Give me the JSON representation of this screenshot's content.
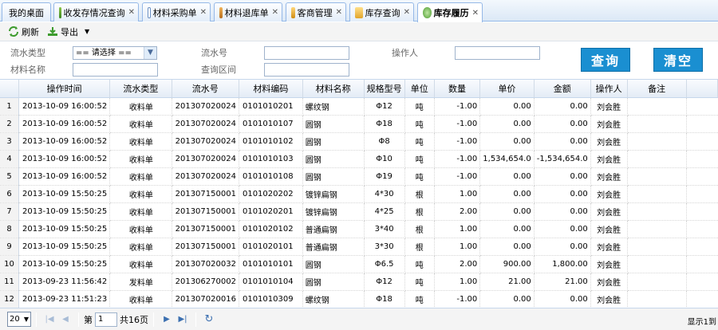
{
  "tabs": [
    {
      "label": "我的桌面",
      "closable": false
    },
    {
      "label": "收发存情况查询",
      "closable": true,
      "icon": "chart-icon"
    },
    {
      "label": "材料采购单",
      "closable": true,
      "icon": "document-icon"
    },
    {
      "label": "材料退库单",
      "closable": true,
      "icon": "truck-icon"
    },
    {
      "label": "客商管理",
      "closable": true,
      "icon": "merchant-icon"
    },
    {
      "label": "库存查询",
      "closable": true,
      "icon": "folder-icon"
    },
    {
      "label": "库存履历",
      "closable": true,
      "icon": "globe-icon",
      "active": true
    }
  ],
  "toolbar": {
    "refresh_label": "刷新",
    "export_label": "导出",
    "export_arrow": "▼"
  },
  "form": {
    "flow_type_label": "流水类型",
    "flow_type_value": "== 请选择 ==",
    "flow_no_label": "流水号",
    "operator_label": "操作人",
    "material_name_label": "材料名称",
    "query_range_label": "查询区间",
    "search_button": "查询",
    "clear_button": "清空"
  },
  "table": {
    "columns": [
      "操作时间",
      "流水类型",
      "流水号",
      "材料编码",
      "材料名称",
      "规格型号",
      "单位",
      "数量",
      "单价",
      "金额",
      "操作人",
      "备注"
    ],
    "rows": [
      [
        "1",
        "2013-10-09 16:00:52",
        "收料单",
        "201307020024",
        "0101010201",
        "螺纹钢",
        "Φ12",
        "吨",
        "-1.00",
        "0.00",
        "0.00",
        "刘会胜",
        ""
      ],
      [
        "2",
        "2013-10-09 16:00:52",
        "收料单",
        "201307020024",
        "0101010107",
        "圆钢",
        "Φ18",
        "吨",
        "-1.00",
        "0.00",
        "0.00",
        "刘会胜",
        ""
      ],
      [
        "3",
        "2013-10-09 16:00:52",
        "收料单",
        "201307020024",
        "0101010102",
        "圆钢",
        "Φ8",
        "吨",
        "-1.00",
        "0.00",
        "0.00",
        "刘会胜",
        ""
      ],
      [
        "4",
        "2013-10-09 16:00:52",
        "收料单",
        "201307020024",
        "0101010103",
        "圆钢",
        "Φ10",
        "吨",
        "-1.00",
        "1,534,654.0",
        "-1,534,654.0",
        "刘会胜",
        ""
      ],
      [
        "5",
        "2013-10-09 16:00:52",
        "收料单",
        "201307020024",
        "0101010108",
        "圆钢",
        "Φ19",
        "吨",
        "-1.00",
        "0.00",
        "0.00",
        "刘会胜",
        ""
      ],
      [
        "6",
        "2013-10-09 15:50:25",
        "收料单",
        "201307150001",
        "0101020202",
        "镀锌扁钢",
        "4*30",
        "根",
        "1.00",
        "0.00",
        "0.00",
        "刘会胜",
        ""
      ],
      [
        "7",
        "2013-10-09 15:50:25",
        "收料单",
        "201307150001",
        "0101020201",
        "镀锌扁钢",
        "4*25",
        "根",
        "2.00",
        "0.00",
        "0.00",
        "刘会胜",
        ""
      ],
      [
        "8",
        "2013-10-09 15:50:25",
        "收料单",
        "201307150001",
        "0101020102",
        "普通扁钢",
        "3*40",
        "根",
        "1.00",
        "0.00",
        "0.00",
        "刘会胜",
        ""
      ],
      [
        "9",
        "2013-10-09 15:50:25",
        "收料单",
        "201307150001",
        "0101020101",
        "普通扁钢",
        "3*30",
        "根",
        "1.00",
        "0.00",
        "0.00",
        "刘会胜",
        ""
      ],
      [
        "10",
        "2013-10-09 15:50:25",
        "收料单",
        "201307020032",
        "0101010101",
        "圆钢",
        "Φ6.5",
        "吨",
        "2.00",
        "900.00",
        "1,800.00",
        "刘会胜",
        ""
      ],
      [
        "11",
        "2013-09-23 11:56:42",
        "发料单",
        "201306270002",
        "0101010104",
        "圆钢",
        "Φ12",
        "吨",
        "1.00",
        "21.00",
        "21.00",
        "刘会胜",
        ""
      ],
      [
        "12",
        "2013-09-23 11:51:23",
        "收料单",
        "201307020016",
        "0101010309",
        "螺纹钢",
        "Φ18",
        "吨",
        "-1.00",
        "0.00",
        "0.00",
        "刘会胜",
        ""
      ]
    ]
  },
  "pager": {
    "page_size": "20",
    "page_prefix": "第",
    "current_page": "1",
    "total_pages_text": "共16页",
    "display_info": "显示1到"
  },
  "colors": {
    "accent_button": "#1a8fd1",
    "tab_border": "#95b8e7"
  }
}
